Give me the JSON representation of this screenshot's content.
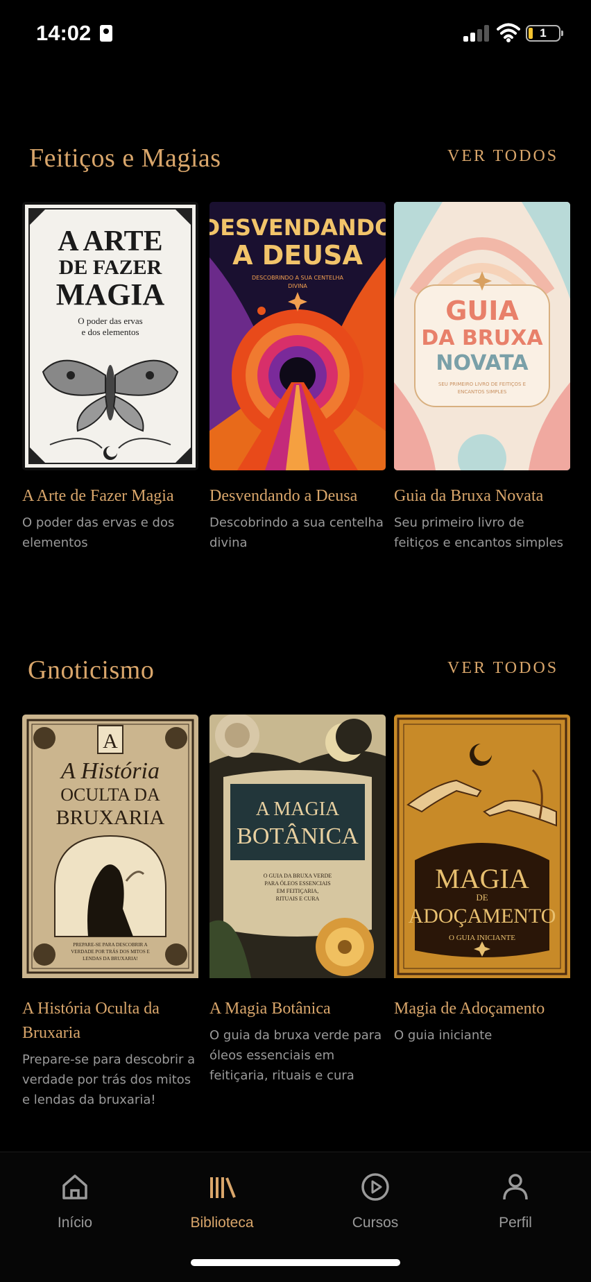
{
  "status_bar": {
    "time": "14:02",
    "battery": "1"
  },
  "sections": [
    {
      "title": "Feitiços e Magias",
      "see_all": "VER TODOS",
      "books": [
        {
          "title": "A Arte de Fazer Magia",
          "subtitle": "O poder das ervas e dos elementos",
          "cover": {
            "line1": "A ARTE",
            "line2": "DE FAZER",
            "line3": "MAGIA",
            "tagline1": "O poder das ervas",
            "tagline2": "e dos elementos"
          }
        },
        {
          "title": "Desvendando a Deusa",
          "subtitle": "Descobrindo a sua centelha divina",
          "cover": {
            "line1": "DESVENDANDO",
            "line2": "A DEUSA",
            "tagline1": "DESCOBRINDO A SUA CENTELHA",
            "tagline2": "DIVINA"
          }
        },
        {
          "title": "Guia da Bruxa Novata",
          "subtitle": "Seu primeiro livro de feitiços e encantos simples",
          "cover": {
            "line1": "GUIA",
            "line2": "DA BRUXA",
            "line3": "NOVATA",
            "tagline1": "SEU PRIMEIRO LIVRO DE FEITIÇOS E",
            "tagline2": "ENCANTOS SIMPLES"
          }
        }
      ]
    },
    {
      "title": "Gnoticismo",
      "see_all": "VER TODOS",
      "books": [
        {
          "title": "A História Oculta da Bruxaria",
          "subtitle": "Prepare-se para descobrir a verdade por trás dos mitos e lendas da bruxaria!",
          "cover": {
            "badge": "A",
            "line1": "A História",
            "line2": "OCULTA DA",
            "line3": "BRUXARIA",
            "tagline1": "PREPARE-SE PARA DESCOBRIR A",
            "tagline2": "VERDADE POR TRÁS DOS MITOS E",
            "tagline3": "LENDAS DA BRUXARIA!"
          }
        },
        {
          "title": "A Magia Botânica",
          "subtitle": "O guia da bruxa verde para óleos essenciais em feitiçaria, rituais e cura",
          "cover": {
            "line1": "A MAGIA",
            "line2": "BOTÂNICA",
            "tagline1": "O GUIA DA BRUXA VERDE",
            "tagline2": "PARA ÓLEOS ESSENCIAIS",
            "tagline3": "EM FEITIÇARIA,",
            "tagline4": "RITUAIS E CURA"
          }
        },
        {
          "title": "Magia de Adoçamento",
          "subtitle": "O guia iniciante",
          "cover": {
            "line1": "MAGIA",
            "line2": "DE",
            "line3": "ADOÇAMENTO",
            "tagline1": "O GUIA INICIANTE"
          }
        }
      ]
    }
  ],
  "tabbar": [
    {
      "label": "Início",
      "icon": "home-icon"
    },
    {
      "label": "Biblioteca",
      "icon": "library-icon",
      "active": true
    },
    {
      "label": "Cursos",
      "icon": "play-circle-icon"
    },
    {
      "label": "Perfil",
      "icon": "person-icon"
    }
  ],
  "colors": {
    "accent": "#d9a66b",
    "muted": "#9a9a9a",
    "background": "#000000"
  }
}
